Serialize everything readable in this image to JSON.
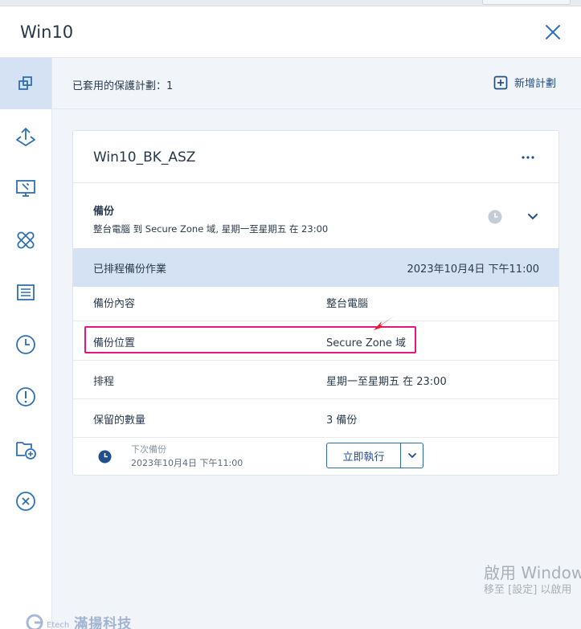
{
  "window": {
    "title": "Win10"
  },
  "sidebar": {
    "items": [
      {
        "icon": "protection-plans-icon",
        "active": true
      },
      {
        "icon": "recovery-icon"
      },
      {
        "icon": "remote-desktop-icon"
      },
      {
        "icon": "patch-icon"
      },
      {
        "icon": "inventory-icon"
      },
      {
        "icon": "history-icon"
      },
      {
        "icon": "alert-icon"
      },
      {
        "icon": "add-to-group-icon"
      },
      {
        "icon": "remove-icon"
      }
    ]
  },
  "topbar": {
    "applied_label": "已套用的保護計劃：1",
    "add_plan_label": "新增計劃"
  },
  "plan": {
    "name": "Win10_BK_ASZ",
    "backup": {
      "label": "備份",
      "description": "整台電腦 到 Secure Zone 域, 星期一至星期五 在 23:00"
    },
    "scheduled": {
      "label": "已排程備份作業",
      "value": "2023年10月4日 下午11:00"
    },
    "rows": [
      {
        "key": "備份內容",
        "value": "整台電腦"
      },
      {
        "key": "備份位置",
        "value": "Secure Zone 域"
      },
      {
        "key": "排程",
        "value": "星期一至星期五 在 23:00"
      },
      {
        "key": "保留的數量",
        "value": "3 備份"
      }
    ],
    "next": {
      "label": "下次備份",
      "date": "2023年10月4日 下午11:00"
    },
    "run_now_label": "立即執行"
  },
  "watermark": {
    "line1": "啟用 Windows",
    "line2": "移至 [設定] 以啟用"
  },
  "logo": {
    "text": "滿揚科技",
    "tag": "Etech"
  },
  "colors": {
    "accent": "#1e4f8c",
    "active_bg": "#d4e2f3",
    "highlight": "#e6157f"
  }
}
